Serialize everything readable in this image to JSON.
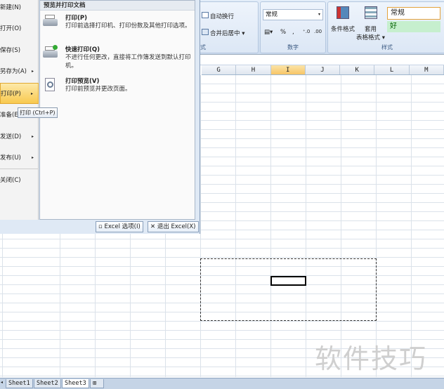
{
  "ribbon": {
    "wrap_text": "自动换行",
    "merge_center": "合并后居中 ▾",
    "alignment_group": "式",
    "number_format": "常规",
    "percent": "%",
    "comma": ",",
    "number_group": "数字",
    "conditional_format": "条件格式",
    "table_format_1": "套用",
    "table_format_2": "表格格式 ▾",
    "style_normal": "常规",
    "style_good": "好",
    "styles_group": "样式"
  },
  "columns": [
    "G",
    "H",
    "I",
    "J",
    "K",
    "L",
    "M"
  ],
  "selected_column": "I",
  "menu": {
    "items": [
      {
        "label": "新建(N)"
      },
      {
        "label": "打开(O)"
      },
      {
        "label": "保存(S)"
      },
      {
        "label": "另存为(A)",
        "arrow": "▸"
      },
      {
        "label": "打印(P)",
        "arrow": "▸"
      },
      {
        "label": "准备(E)",
        "arrow": "▸"
      },
      {
        "label": "发送(D)",
        "arrow": "▸"
      },
      {
        "label": "发布(U)",
        "arrow": "▸"
      },
      {
        "label": "关闭(C)"
      }
    ],
    "panel_title": "预览并打印文档",
    "options": [
      {
        "title": "打印(P)",
        "desc": "打印前选择打印机、打印份数及其他打印选项。"
      },
      {
        "title": "快速打印(Q)",
        "desc": "不进行任何更改，直接将工作簿发送到默认打印机。"
      },
      {
        "title": "打印预览(V)",
        "desc": "打印前预览并更改页面。"
      }
    ],
    "excel_options": "Excel 选项(I)",
    "exit_excel": "退出 Excel(X)",
    "tooltip": "打印 (Ctrl+P)"
  },
  "sheets": [
    "Sheet1",
    "Sheet2",
    "Sheet3"
  ],
  "active_sheet": "Sheet3",
  "watermark": "软件技巧"
}
